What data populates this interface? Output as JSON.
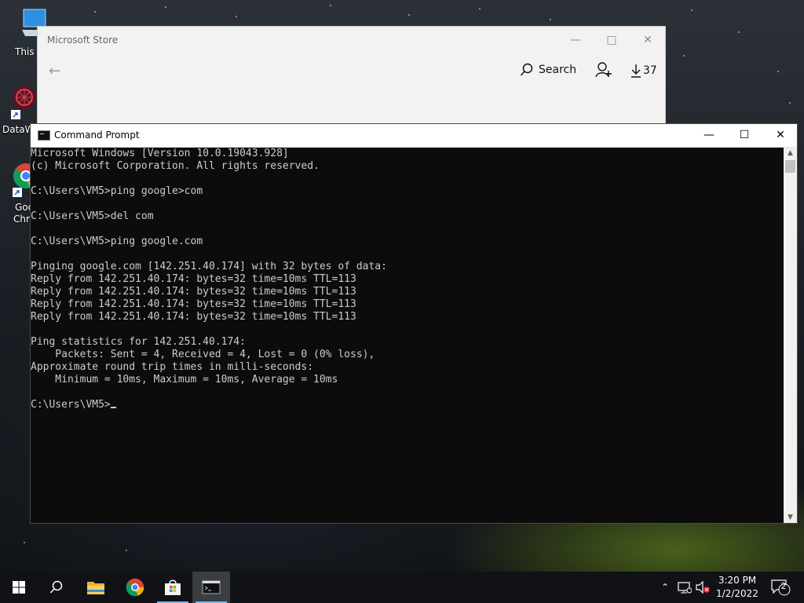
{
  "desktop": {
    "icons": [
      {
        "label": "This P",
        "icon": "pc-icon"
      },
      {
        "label": "DataW",
        "icon": "datawrapper-icon"
      },
      {
        "label": "Goo\nChro",
        "label_line1": "Goo",
        "label_line2": "Chro",
        "icon": "chrome-icon"
      }
    ]
  },
  "store": {
    "title": "Microsoft Store",
    "search_label": "Search",
    "downloads_count": "37"
  },
  "cmd": {
    "title": "Command Prompt",
    "lines": [
      "Microsoft Windows [Version 10.0.19043.928]",
      "(c) Microsoft Corporation. All rights reserved.",
      "",
      "C:\\Users\\VM5>ping google>com",
      "",
      "C:\\Users\\VM5>del com",
      "",
      "C:\\Users\\VM5>ping google.com",
      "",
      "Pinging google.com [142.251.40.174] with 32 bytes of data:",
      "Reply from 142.251.40.174: bytes=32 time=10ms TTL=113",
      "Reply from 142.251.40.174: bytes=32 time=10ms TTL=113",
      "Reply from 142.251.40.174: bytes=32 time=10ms TTL=113",
      "Reply from 142.251.40.174: bytes=32 time=10ms TTL=113",
      "",
      "Ping statistics for 142.251.40.174:",
      "    Packets: Sent = 4, Received = 4, Lost = 0 (0% loss),",
      "Approximate round trip times in milli-seconds:",
      "    Minimum = 10ms, Maximum = 10ms, Average = 10ms",
      ""
    ],
    "prompt": "C:\\Users\\VM5>"
  },
  "taskbar": {
    "apps": [
      {
        "name": "start-button",
        "icon": "windows-logo-icon"
      },
      {
        "name": "search-button",
        "icon": "search-icon"
      },
      {
        "name": "file-explorer-button",
        "icon": "folder-icon"
      },
      {
        "name": "chrome-button",
        "icon": "chrome-icon"
      },
      {
        "name": "store-button",
        "icon": "store-bag-icon"
      },
      {
        "name": "cmd-button",
        "icon": "terminal-icon",
        "active": true
      }
    ],
    "time": "3:20 PM",
    "date": "1/2/2022",
    "notification_count": "2"
  },
  "colors": {
    "console_bg": "#0c0c0c",
    "console_fg": "#cccccc",
    "taskbar_bg": "#101215",
    "accent_blue": "#76b9ed"
  }
}
